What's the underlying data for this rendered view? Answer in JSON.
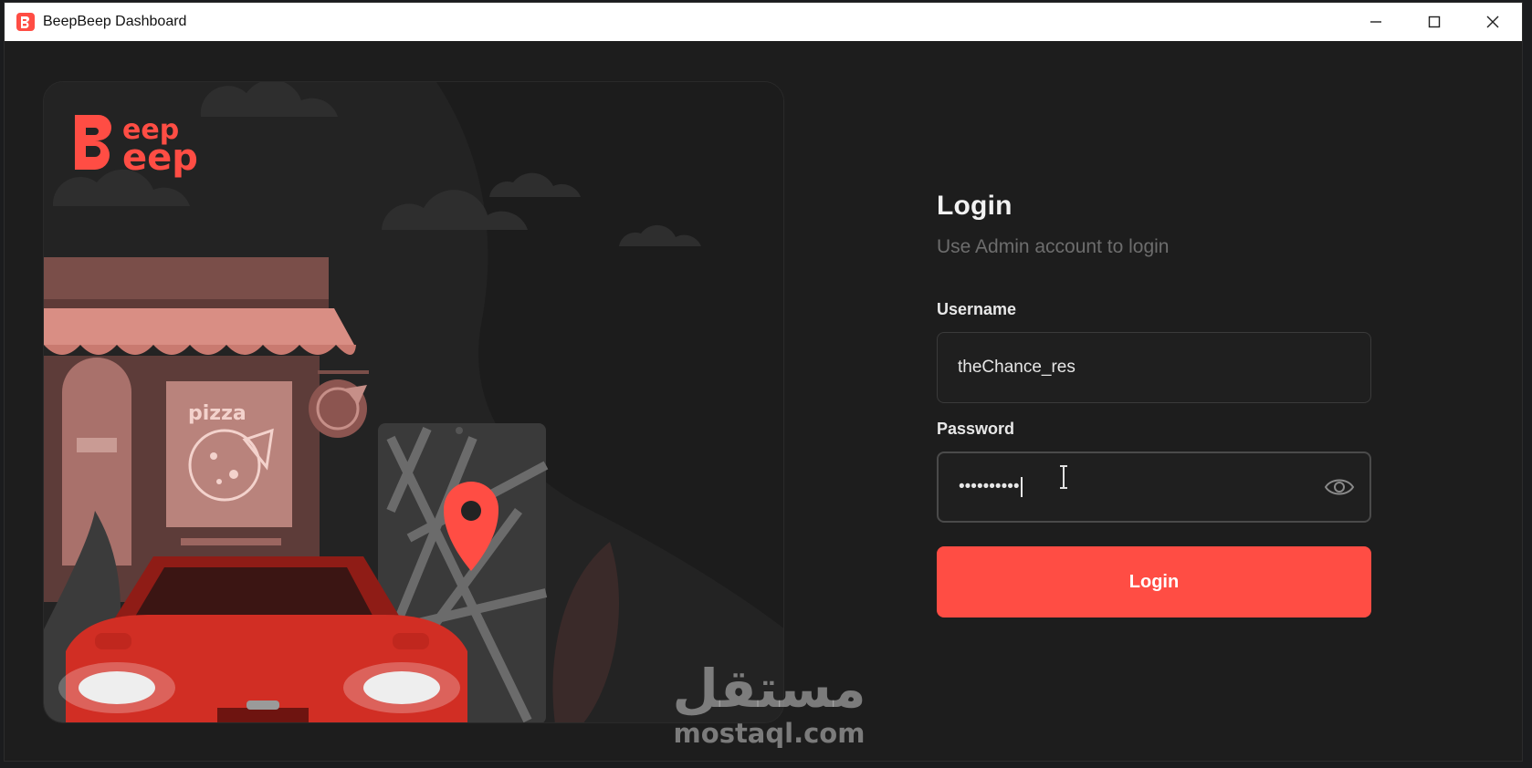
{
  "window": {
    "title": "BeepBeep Dashboard",
    "controls": [
      "minimize",
      "maximize",
      "close"
    ]
  },
  "brand": {
    "logo_text": "Beep Beep",
    "colors": {
      "primary": "#ff4d44",
      "background": "#1d1d1d"
    }
  },
  "illustration": {
    "sign_text": "pizza",
    "icons": [
      "cloud-icon",
      "pizza-sign-icon",
      "map-pin-icon",
      "car-icon",
      "leaf-icon"
    ]
  },
  "login": {
    "title": "Login",
    "subtitle": "Use Admin account to login",
    "username_label": "Username",
    "username_value": "theChance_res",
    "password_label": "Password",
    "password_masked": "••••••••••",
    "button_label": "Login"
  },
  "watermark": {
    "arabic": "مستقل",
    "latin": "mostaql.com"
  }
}
